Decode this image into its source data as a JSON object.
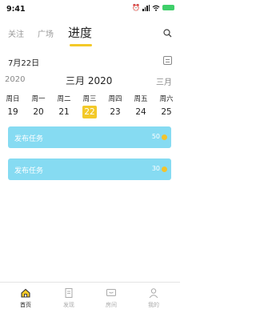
{
  "status_bar": {
    "time": "9:41"
  },
  "top_tabs": [
    {
      "label": "关注"
    },
    {
      "label": "广场"
    },
    {
      "label": "进度"
    }
  ],
  "date_label": "7月22日",
  "calendar": {
    "prev_label": "2020",
    "current": "三月 2020",
    "next_label": "三月",
    "weekdays": [
      "周日",
      "周一",
      "周二",
      "周三",
      "周四",
      "周五",
      "周六"
    ],
    "days": [
      "19",
      "20",
      "21",
      "22",
      "23",
      "24",
      "25"
    ],
    "selected_index": 3
  },
  "tasks": [
    {
      "title": "发布任务",
      "points": "50"
    },
    {
      "title": "发布任务",
      "points": "30"
    }
  ],
  "bottom_nav": [
    {
      "label": "首页",
      "icon": "home-icon",
      "active": true
    },
    {
      "label": "发现",
      "icon": "document-icon",
      "active": false
    },
    {
      "label": "房间",
      "icon": "message-icon",
      "active": false
    },
    {
      "label": "我的",
      "icon": "person-icon",
      "active": false
    }
  ],
  "colors": {
    "accent": "#f3c928",
    "card": "#86dbf2",
    "coin": "#f2c32c"
  }
}
